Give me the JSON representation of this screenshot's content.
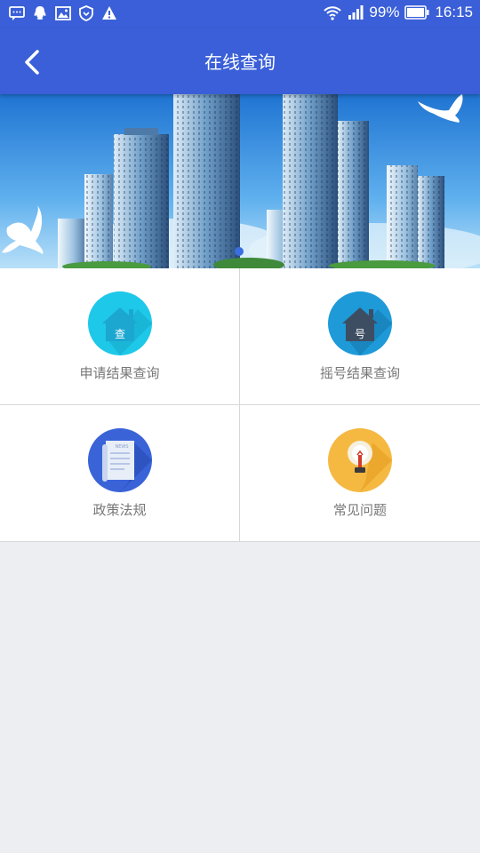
{
  "status_bar": {
    "battery": "99%",
    "time": "16:15",
    "left_icons": [
      "message-icon",
      "qq-icon",
      "image-icon",
      "shield-icon",
      "warning-icon"
    ],
    "right_icons": [
      "wifi-icon",
      "signal-icon",
      "battery-icon"
    ]
  },
  "header": {
    "title": "在线查询",
    "back_icon": "chevron-left-icon"
  },
  "banner": {
    "slide_count": 1,
    "active_slide": 1
  },
  "menu": {
    "items": [
      {
        "label": "申请结果查询",
        "icon": "house-query-icon",
        "badge": "查",
        "color": "#1ec8e8"
      },
      {
        "label": "摇号结果查询",
        "icon": "house-number-icon",
        "badge": "号",
        "color": "#1e9ad8"
      },
      {
        "label": "政策法规",
        "icon": "news-document-icon",
        "badge": "NEWS",
        "color": "#3a63d8"
      },
      {
        "label": "常见问题",
        "icon": "lightbulb-icon",
        "badge": "",
        "color": "#f5b942"
      }
    ]
  },
  "colors": {
    "primary": "#3a5fd8",
    "background": "#eceef1"
  }
}
